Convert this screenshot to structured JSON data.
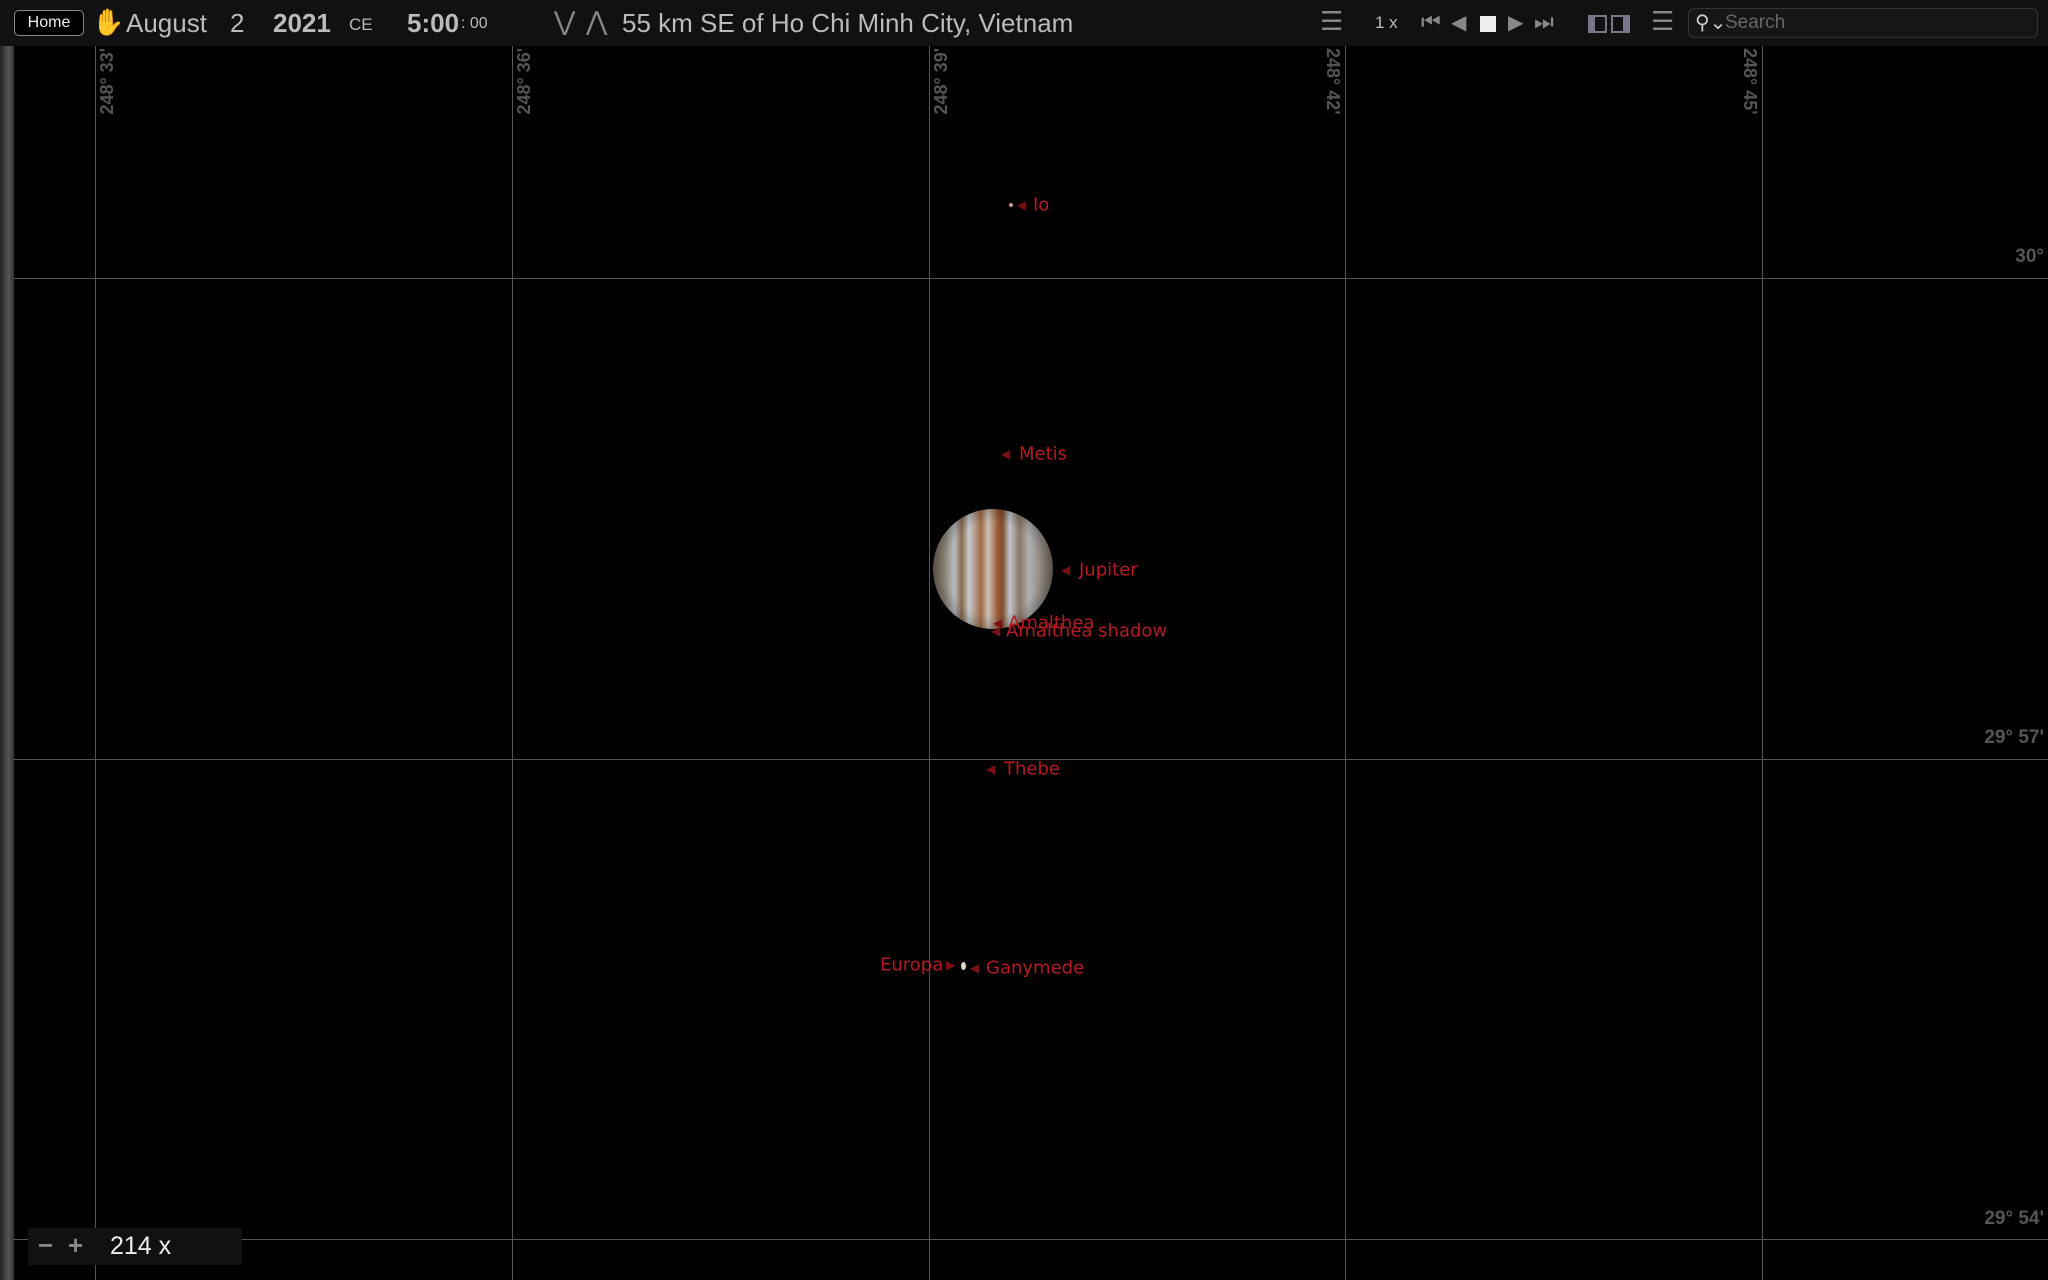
{
  "toolbar": {
    "home": "Home",
    "month": "August",
    "day": "2",
    "year": "2021",
    "era": "CE",
    "time_hm": "5:00",
    "time_s": ": 00",
    "location": "55 km SE of Ho Chi Minh City, Vietnam",
    "speed": "1 x",
    "search_placeholder": "Search"
  },
  "grid": {
    "ra_labels": [
      "248° 33'",
      "248° 36'",
      "248° 39'",
      "248° 42'",
      "248° 45'"
    ],
    "dec_labels": [
      "30°",
      "29° 57'",
      "29° 54'"
    ]
  },
  "objects": {
    "io": "Io",
    "metis": "Metis",
    "jupiter": "Jupiter",
    "amalthea": "Amalthea",
    "amalthea_shadow": "Amalthea shadow",
    "thebe": "Thebe",
    "europa": "Europa",
    "ganymede": "Ganymede"
  },
  "zoom": {
    "level": "214 x"
  },
  "colors": {
    "label": "#b51a22",
    "grid": "#555555",
    "background": "#000000"
  }
}
